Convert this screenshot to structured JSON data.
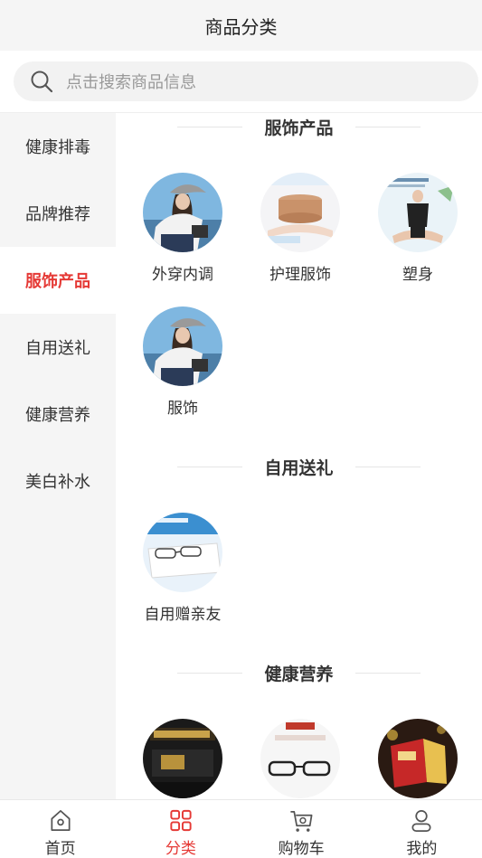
{
  "header": {
    "title": "商品分类"
  },
  "search": {
    "placeholder": "点击搜索商品信息"
  },
  "sidebar": {
    "items": [
      {
        "label": "健康排毒"
      },
      {
        "label": "品牌推荐"
      },
      {
        "label": "服饰产品"
      },
      {
        "label": "自用送礼"
      },
      {
        "label": "健康营养"
      },
      {
        "label": "美白补水"
      }
    ],
    "active_index": 2
  },
  "sections": [
    {
      "title": "服饰产品",
      "items": [
        {
          "label": "外穿内调",
          "image": "woman-in-cap"
        },
        {
          "label": "护理服饰",
          "image": "beige-band"
        },
        {
          "label": "塑身",
          "image": "shapewear"
        },
        {
          "label": "服饰",
          "image": "woman-in-cap"
        }
      ]
    },
    {
      "title": "自用送礼",
      "items": [
        {
          "label": "自用赠亲友",
          "image": "glasses-box"
        }
      ]
    },
    {
      "title": "健康营养",
      "items": [
        {
          "label": "",
          "image": "dark-product"
        },
        {
          "label": "",
          "image": "glasses"
        },
        {
          "label": "",
          "image": "red-boxes"
        }
      ]
    }
  ],
  "tabbar": {
    "items": [
      {
        "label": "首页",
        "icon": "home-icon"
      },
      {
        "label": "分类",
        "icon": "category-icon"
      },
      {
        "label": "购物车",
        "icon": "cart-icon"
      },
      {
        "label": "我的",
        "icon": "user-icon"
      }
    ],
    "active_index": 1
  },
  "colors": {
    "accent": "#e53935",
    "background": "#f5f5f5"
  }
}
